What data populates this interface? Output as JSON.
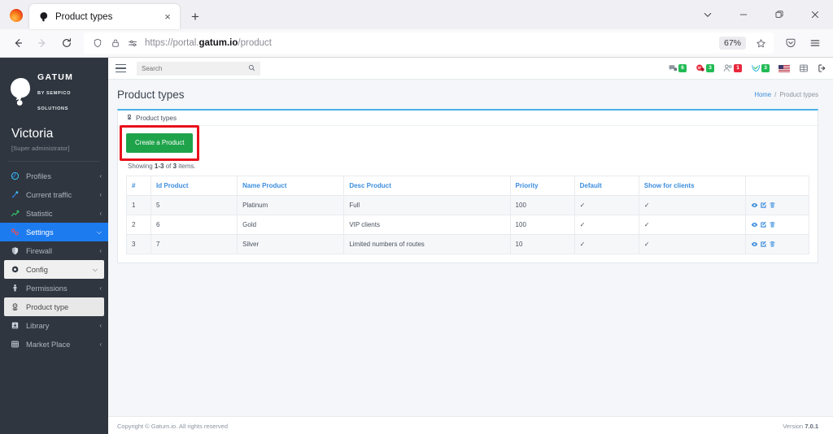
{
  "browser": {
    "tab": {
      "title": "Product types",
      "favicon": "gatum-logo-icon",
      "close": "×"
    },
    "new_tab_label": "+",
    "window_controls": {
      "list_all_tabs": "chevron-down-icon",
      "minimize": "—",
      "maximize": "restore-icon",
      "close": "×"
    },
    "nav": {
      "back": "←",
      "forward": "→",
      "reload": "⟳"
    },
    "url": {
      "prefix": "https://portal.",
      "domain": "gatum.io",
      "path": "/product",
      "full": "https://portal.gatum.io/product"
    },
    "zoom_level": "67%",
    "bookmark_icon": "star-icon",
    "pocket_icon": "pocket-icon",
    "app_menu_icon": "hamburger-menu-icon"
  },
  "sidebar": {
    "brand": {
      "name": "GATUM",
      "sub": "BY SEMPICO SOLUTIONS",
      "logo": "gatum-logo-icon"
    },
    "user": {
      "name": "Victoria",
      "role": "[Super administrator]"
    },
    "items": [
      {
        "label": "Profiles",
        "icon": "profiles-icon",
        "caret": "‹",
        "state": "normal"
      },
      {
        "label": "Current traffic",
        "icon": "traffic-icon",
        "caret": "‹",
        "state": "normal"
      },
      {
        "label": "Statistic",
        "icon": "statistic-icon",
        "caret": "‹",
        "state": "normal"
      },
      {
        "label": "Settings",
        "icon": "settings-icon",
        "caret": "⌵",
        "state": "active"
      },
      {
        "label": "Firewall",
        "icon": "shield-icon",
        "caret": "‹",
        "state": "normal"
      },
      {
        "label": "Config",
        "icon": "gear-icon",
        "caret": "⌵",
        "state": "open"
      },
      {
        "label": "Permissions",
        "icon": "permissions-icon",
        "caret": "‹",
        "state": "normal"
      },
      {
        "label": "Product type",
        "icon": "product-type-icon",
        "caret": "",
        "state": "selected"
      },
      {
        "label": "Library",
        "icon": "library-icon",
        "caret": "‹",
        "state": "normal"
      },
      {
        "label": "Market Place",
        "icon": "market-place-icon",
        "caret": "‹",
        "state": "normal"
      }
    ]
  },
  "topbar": {
    "menu_toggle": "hamburger-menu-icon",
    "search": {
      "placeholder": "Search",
      "value": "",
      "icon": "search-icon"
    },
    "icons": [
      {
        "name": "messages-icon",
        "badge": "6",
        "badge_color": "#22bb55"
      },
      {
        "name": "alerts-icon",
        "badge": "3",
        "badge_color": "#22bb55"
      },
      {
        "name": "users-icon",
        "badge": "1",
        "badge_color": "#e8283c"
      },
      {
        "name": "support-icon",
        "badge": "3",
        "badge_color": "#22bb55"
      },
      {
        "name": "language-flag-icon",
        "badge": "",
        "badge_color": ""
      },
      {
        "name": "apps-grid-icon",
        "badge": "",
        "badge_color": ""
      },
      {
        "name": "logout-icon",
        "badge": "",
        "badge_color": ""
      }
    ]
  },
  "page": {
    "title": "Product types",
    "breadcrumb": {
      "home": "Home",
      "separator": "/",
      "current": "Product types"
    }
  },
  "card": {
    "header": {
      "icon": "product-type-icon",
      "label": "Product types"
    },
    "create_button": "Create a Product",
    "highlight_color": "#e8111b",
    "showing": {
      "prefix": "Showing ",
      "range": "1-3",
      "middle": " of ",
      "total": "3",
      "suffix": " items."
    }
  },
  "table": {
    "columns": [
      "#",
      "Id Product",
      "Name Product",
      "Desc Product",
      "Priority",
      "Default",
      "Show for clients",
      ""
    ],
    "rows": [
      {
        "num": "1",
        "id_product": "5",
        "name_product": "Platinum",
        "desc_product": "Full",
        "priority": "100",
        "default": "✓",
        "show_for_clients": "✓",
        "actions": [
          "view-icon",
          "edit-icon",
          "delete-icon"
        ]
      },
      {
        "num": "2",
        "id_product": "6",
        "name_product": "Gold",
        "desc_product": "VIP clients",
        "priority": "100",
        "default": "✓",
        "show_for_clients": "✓",
        "actions": [
          "view-icon",
          "edit-icon",
          "delete-icon"
        ]
      },
      {
        "num": "3",
        "id_product": "7",
        "name_product": "Silver",
        "desc_product": "Limited numbers of routes",
        "priority": "10",
        "default": "✓",
        "show_for_clients": "✓",
        "actions": [
          "view-icon",
          "edit-icon",
          "delete-icon"
        ]
      }
    ]
  },
  "footer": {
    "copyright": "Copyright © Gatum.io. All rights reserved",
    "version_label": "Version ",
    "version_value": "7.0.1"
  }
}
